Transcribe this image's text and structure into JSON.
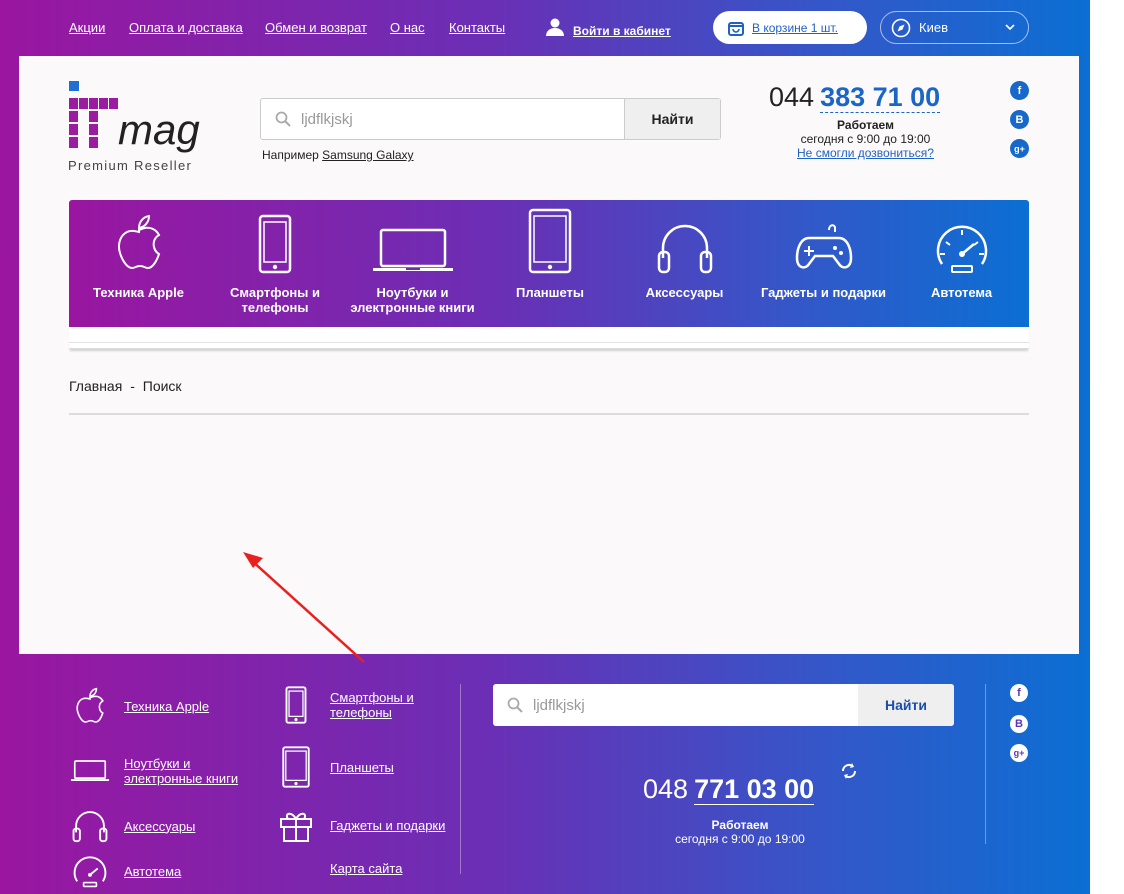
{
  "topbar": {
    "links": [
      "Акции",
      "Оплата и доставка",
      "Обмен и возврат",
      "О нас",
      "Контакты"
    ],
    "cabinet": "Войти в кабинет",
    "cart": "В корзине 1 шт.",
    "city": "Киев",
    "icons": {
      "user": "user-icon",
      "cart": "bag-icon",
      "city": "compass-icon"
    }
  },
  "logo": {
    "brand": "ITmag",
    "tagline": "Premium Reseller"
  },
  "search": {
    "value": "ljdflkjskj",
    "button": "Найти",
    "example_prefix": "Например",
    "example_link": "Samsung Galaxy"
  },
  "contact": {
    "prefix": "044",
    "number": "383 71 00",
    "work_title": "Работаем",
    "work_hours": "сегодня с 9:00 до 19:00",
    "callback": "Не смогли дозвониться?"
  },
  "social": [
    "f",
    "В",
    "g+"
  ],
  "categories": [
    {
      "label": "Техника Apple",
      "icon": "apple-icon"
    },
    {
      "label": "Смартфоны и телефоны",
      "icon": "smartphone-icon"
    },
    {
      "label": "Ноутбуки и электронные книги",
      "icon": "laptop-icon"
    },
    {
      "label": "Планшеты",
      "icon": "tablet-icon"
    },
    {
      "label": "Аксессуары",
      "icon": "headphones-icon"
    },
    {
      "label": "Гаджеты и подарки",
      "icon": "gamepad-icon"
    },
    {
      "label": "Автотема",
      "icon": "speedometer-icon"
    }
  ],
  "breadcrumbs": {
    "home": "Главная",
    "sep": "-",
    "current": "Поиск"
  },
  "footer": {
    "links": [
      {
        "label": "Техника Apple",
        "icon": "apple-icon"
      },
      {
        "label": "Смартфоны и телефоны",
        "icon": "smartphone-icon"
      },
      {
        "label": "Ноутбуки и электронные книги",
        "icon": "laptop-icon"
      },
      {
        "label": "Планшеты",
        "icon": "tablet-icon"
      },
      {
        "label": "Аксессуары",
        "icon": "headphones-icon"
      },
      {
        "label": "Гаджеты и подарки",
        "icon": "gift-icon"
      },
      {
        "label": "Автотема",
        "icon": "speedometer-icon"
      },
      {
        "label": "Карта сайта",
        "icon": ""
      }
    ],
    "search_value": "ljdflkjskj",
    "search_button": "Найти",
    "phone_prefix": "048",
    "phone_number": "771 03 00",
    "work_title": "Работаем",
    "work_hours": "сегодня с 9:00 до 19:00"
  },
  "colors": {
    "accent": "#1a66c6",
    "gradient_start": "#9a16a0",
    "gradient_end": "#0b6fd3",
    "annotation": "#e8211f"
  }
}
